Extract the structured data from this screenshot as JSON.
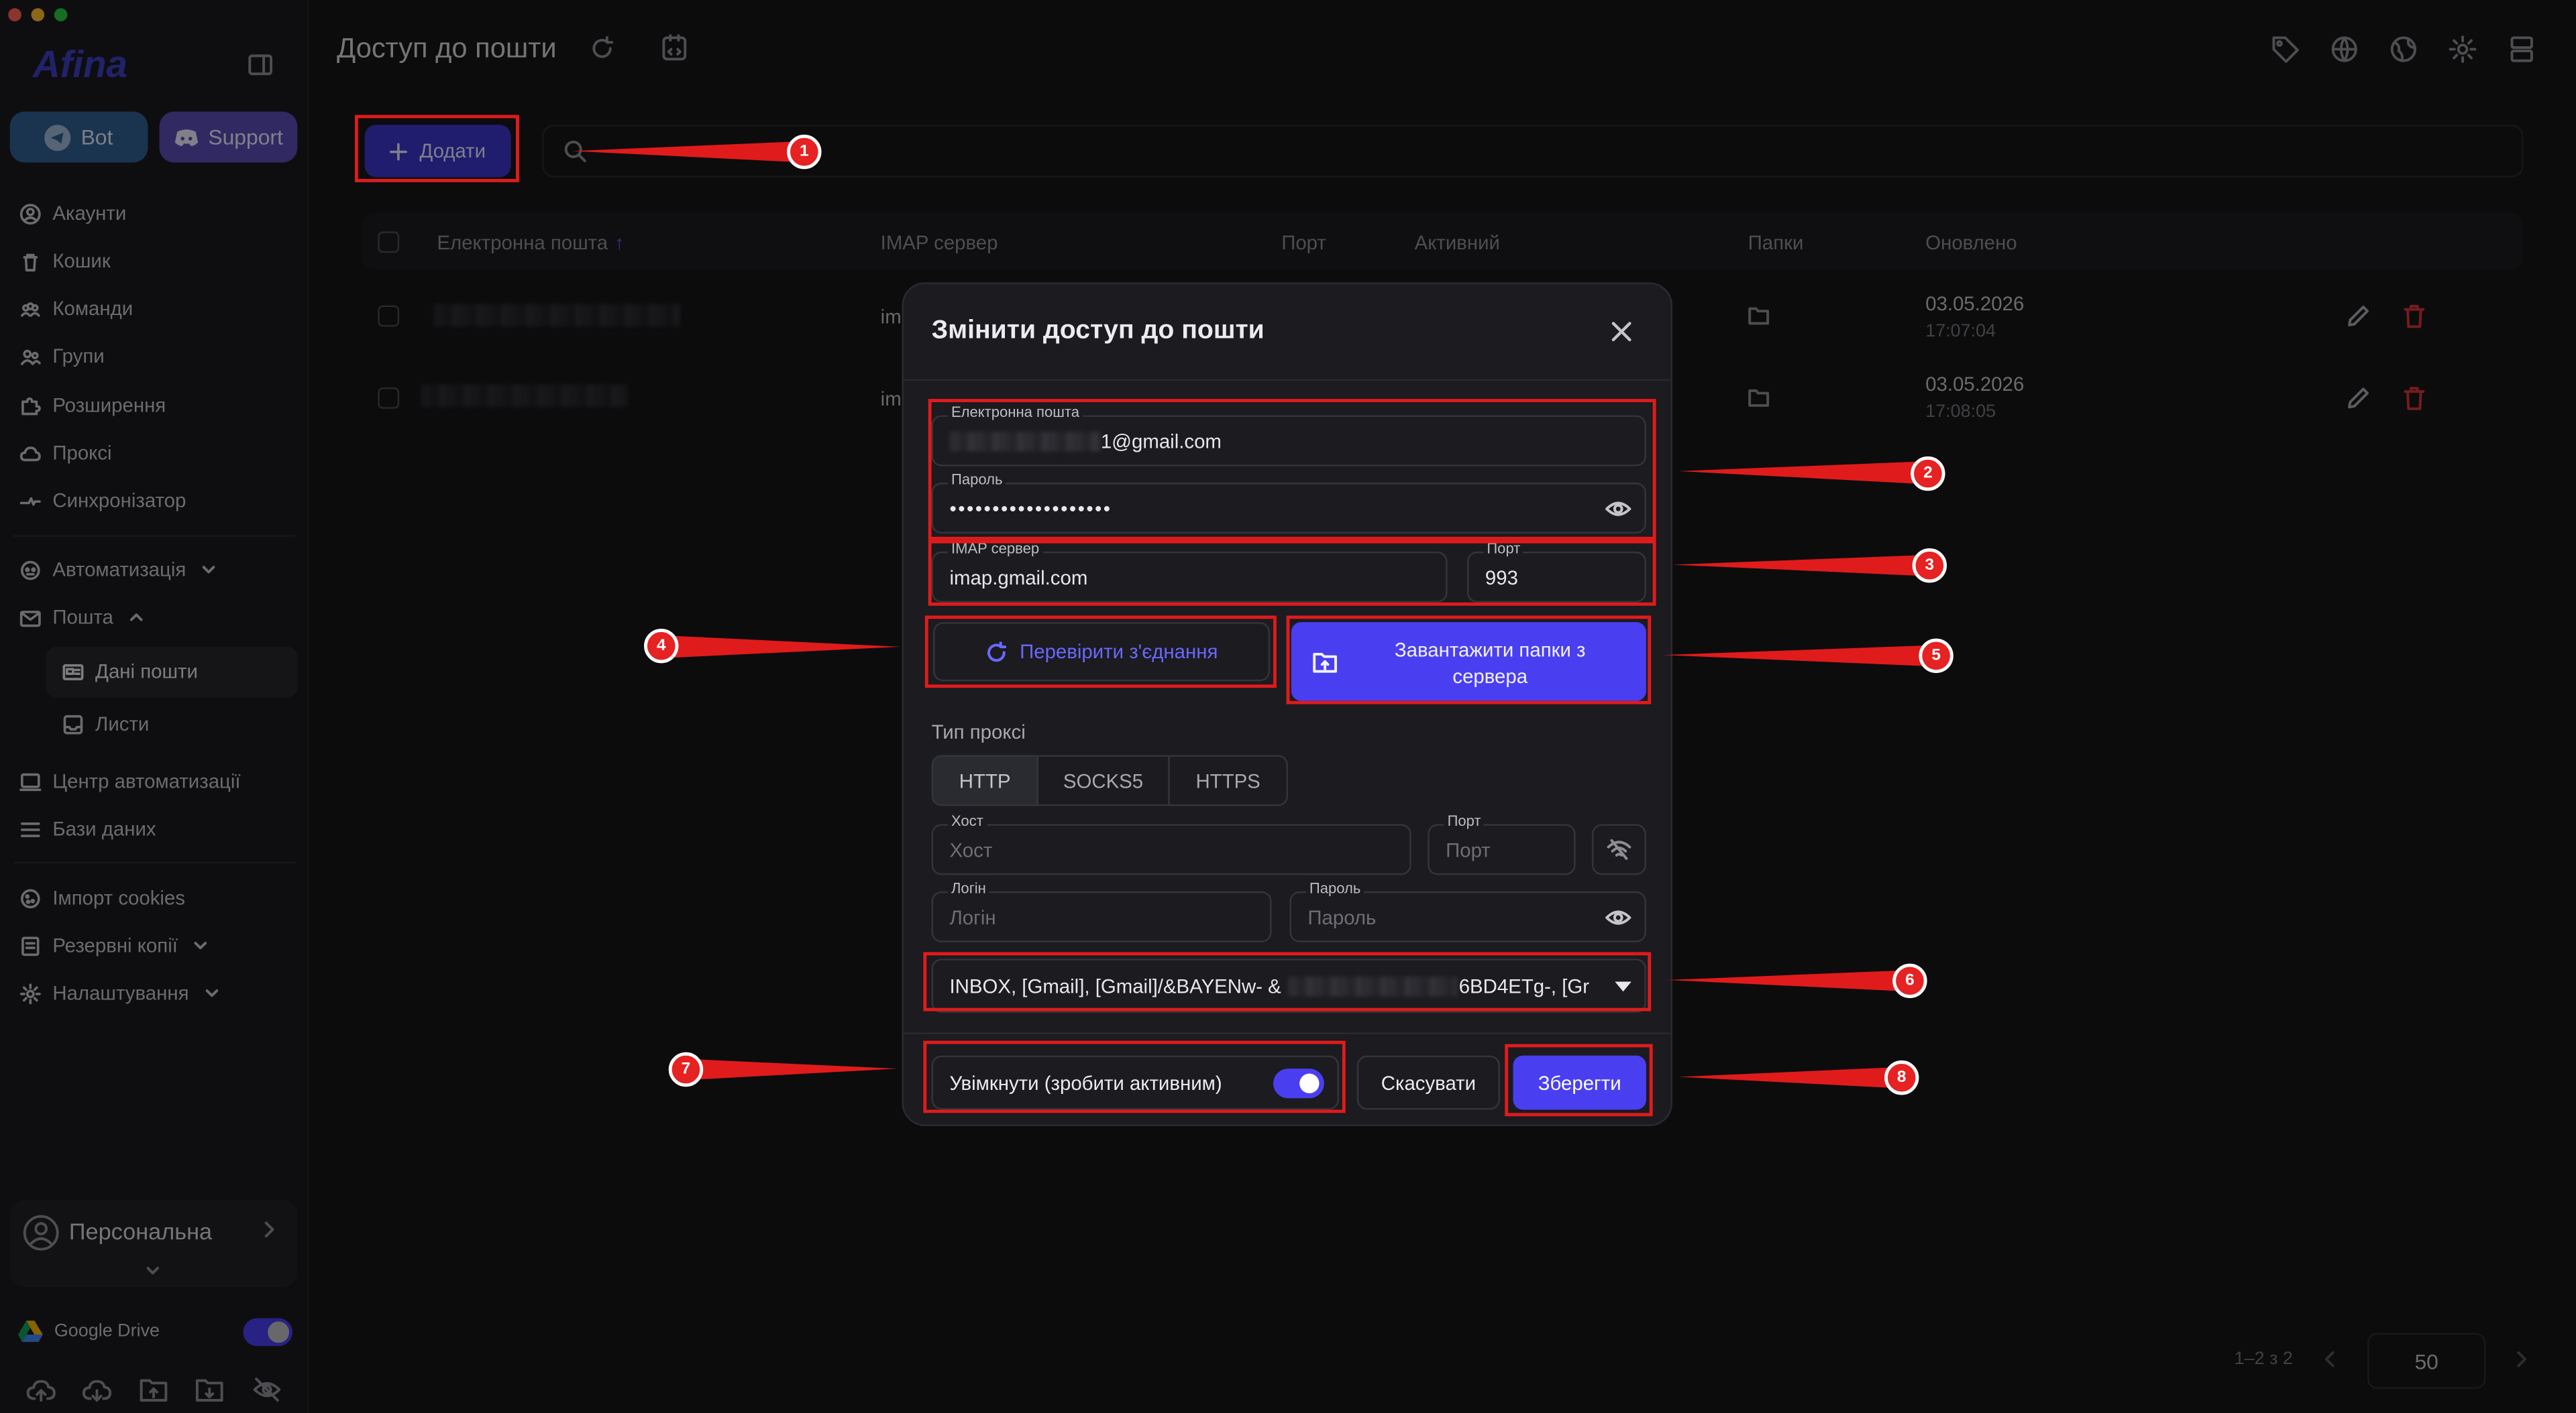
{
  "window": {
    "traffic_lights": [
      "#ff5f57",
      "#febc2e",
      "#28c840"
    ]
  },
  "sidebar": {
    "logo": "Afina",
    "bot_label": "Bot",
    "support_label": "Support",
    "items": [
      {
        "label": "Акаунти",
        "icon": "user-circle-icon"
      },
      {
        "label": "Кошик",
        "icon": "trash-icon"
      },
      {
        "label": "Команди",
        "icon": "team-icon"
      },
      {
        "label": "Групи",
        "icon": "group-icon"
      },
      {
        "label": "Розширення",
        "icon": "puzzle-icon"
      },
      {
        "label": "Проксі",
        "icon": "cloud-icon"
      },
      {
        "label": "Синхронізатор",
        "icon": "sync-icon"
      },
      {
        "label": "Автоматизація",
        "icon": "robot-icon"
      },
      {
        "label": "Пошта",
        "icon": "mail-icon"
      },
      {
        "label": "Дані пошти",
        "icon": "mail-data-icon"
      },
      {
        "label": "Листи",
        "icon": "inbox-icon"
      },
      {
        "label": "Центр автоматизації",
        "icon": "monitor-icon"
      },
      {
        "label": "Бази даних",
        "icon": "list-icon"
      },
      {
        "label": "Імпорт cookies",
        "icon": "cookie-icon"
      },
      {
        "label": "Резервні копії",
        "icon": "backup-icon"
      },
      {
        "label": "Налаштування",
        "icon": "gear-icon"
      }
    ],
    "profile_label": "Персональна",
    "gdrive_label": "Google Drive"
  },
  "header": {
    "title": "Доступ до пошти"
  },
  "toolbar": {
    "add_label": "Додати"
  },
  "table": {
    "columns": [
      "Електронна пошта",
      "IMAP сервер",
      "Порт",
      "Активний",
      "Папки",
      "Оновлено"
    ],
    "rows": [
      {
        "imap": "im",
        "date": "03.05.2026",
        "time": "17:07:04"
      },
      {
        "imap": "im",
        "date": "03.05.2026",
        "time": "17:08:05"
      }
    ],
    "pagination": "1–2 з 2",
    "page_size": "50"
  },
  "modal": {
    "title": "Змінити доступ до пошти",
    "email_label": "Електронна пошта",
    "email_value": "1@gmail.com",
    "password_label": "Пароль",
    "password_value": "•••••••••••••••••••",
    "imap_label": "IMAP сервер",
    "imap_value": "imap.gmail.com",
    "port_label": "Порт",
    "port_value": "993",
    "check_label": "Перевірити з'єднання",
    "load_label_1": "Завантажити папки з",
    "load_label_2": "сервера",
    "proxy_type_label": "Тип проксі",
    "proxy_types": [
      "HTTP",
      "SOCKS5",
      "HTTPS"
    ],
    "host_label": "Хост",
    "host_placeholder": "Хост",
    "proxy_port_label": "Порт",
    "proxy_port_placeholder": "Порт",
    "login_label": "Логін",
    "login_placeholder": "Логін",
    "proxy_pass_label": "Пароль",
    "proxy_pass_placeholder": "Пароль",
    "folders_left": "INBOX, [Gmail], [Gmail]/&BAYENw- &",
    "folders_right": "6BD4ETg-, [Gr",
    "enable_label": "Увімкнути (зробити активним)",
    "cancel_label": "Скасувати",
    "save_label": "Зберегти"
  },
  "annotations": [
    "1",
    "2",
    "3",
    "4",
    "5",
    "6",
    "7",
    "8"
  ],
  "colors": {
    "accent": "#4a3ff0",
    "annotation": "#e01b1b"
  }
}
